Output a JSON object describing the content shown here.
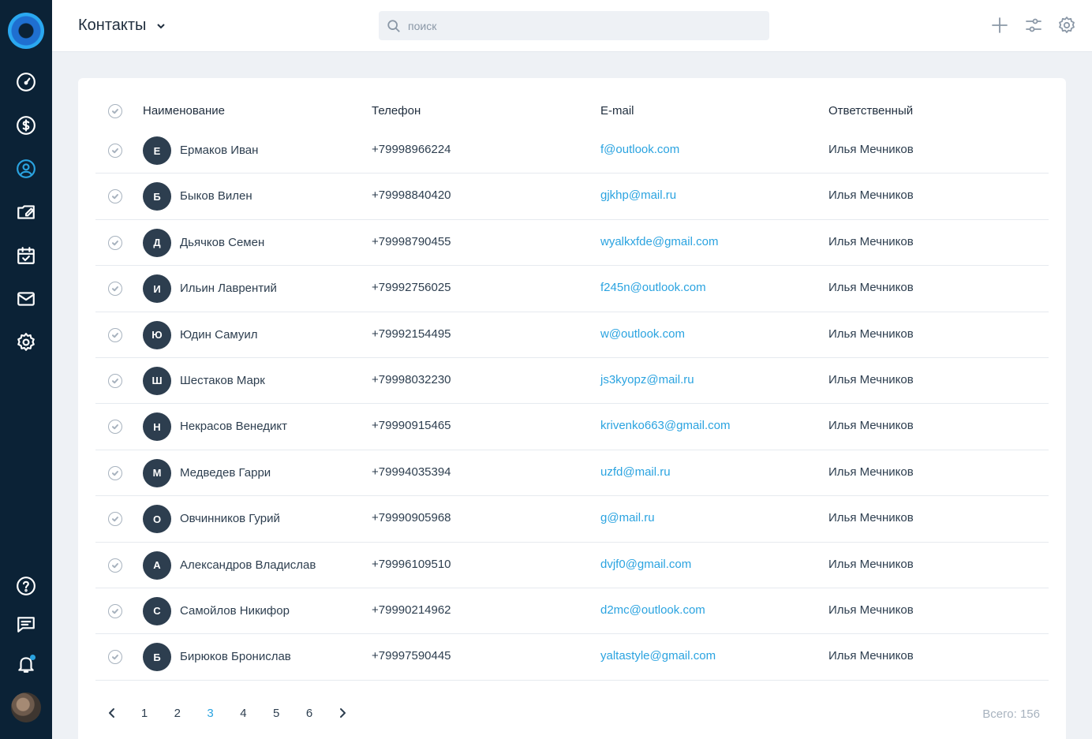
{
  "header": {
    "title": "Контакты",
    "search_placeholder": "поиск",
    "search_value": ""
  },
  "sidebar": {
    "items": [
      {
        "name": "dashboard-icon"
      },
      {
        "name": "deals-icon"
      },
      {
        "name": "contacts-icon",
        "active": true
      },
      {
        "name": "documents-icon"
      },
      {
        "name": "calendar-icon"
      },
      {
        "name": "mail-icon"
      },
      {
        "name": "settings-icon"
      }
    ],
    "bottom": [
      {
        "name": "help-icon"
      },
      {
        "name": "chat-icon"
      },
      {
        "name": "bell-icon"
      }
    ]
  },
  "table": {
    "columns": [
      "Наименование",
      "Телефон",
      "E-mail",
      "Ответственный"
    ],
    "rows": [
      {
        "initial": "Е",
        "name": "Ермаков Иван",
        "phone": "+79998966224",
        "email": "f@outlook.com",
        "owner": "Илья Мечников"
      },
      {
        "initial": "Б",
        "name": "Быков Вилен",
        "phone": "+79998840420",
        "email": "gjkhp@mail.ru",
        "owner": "Илья Мечников"
      },
      {
        "initial": "Д",
        "name": "Дьячков Семен",
        "phone": "+79998790455",
        "email": "wyalkxfde@gmail.com",
        "owner": "Илья Мечников"
      },
      {
        "initial": "И",
        "name": "Ильин Лаврентий",
        "phone": "+79992756025",
        "email": "f245n@outlook.com",
        "owner": "Илья Мечников"
      },
      {
        "initial": "Ю",
        "name": "Юдин Самуил",
        "phone": "+79992154495",
        "email": "w@outlook.com",
        "owner": "Илья Мечников"
      },
      {
        "initial": "Ш",
        "name": "Шестаков Марк",
        "phone": "+79998032230",
        "email": "js3kyopz@mail.ru",
        "owner": "Илья Мечников"
      },
      {
        "initial": "Н",
        "name": "Некрасов Венедикт",
        "phone": "+79990915465",
        "email": "krivenko663@gmail.com",
        "owner": "Илья Мечников"
      },
      {
        "initial": "М",
        "name": "Медведев Гарри",
        "phone": "+79994035394",
        "email": "uzfd@mail.ru",
        "owner": "Илья Мечников"
      },
      {
        "initial": "О",
        "name": "Овчинников Гурий",
        "phone": "+79990905968",
        "email": "g@mail.ru",
        "owner": "Илья Мечников"
      },
      {
        "initial": "А",
        "name": "Александров Владислав",
        "phone": "+79996109510",
        "email": "dvjf0@gmail.com",
        "owner": "Илья Мечников"
      },
      {
        "initial": "С",
        "name": "Самойлов Никифор",
        "phone": "+79990214962",
        "email": "d2mc@outlook.com",
        "owner": "Илья Мечников"
      },
      {
        "initial": "Б",
        "name": "Бирюков Бронислав",
        "phone": "+79997590445",
        "email": "yaltastyle@gmail.com",
        "owner": "Илья Мечников"
      }
    ]
  },
  "pagination": {
    "pages": [
      "1",
      "2",
      "3",
      "4",
      "5",
      "6"
    ],
    "current": "3",
    "total_label": "Всего: 156"
  },
  "colors": {
    "sidebar_bg": "#0b2236",
    "accent": "#2aa3e0",
    "avatar_bg": "#2d3e4f"
  }
}
